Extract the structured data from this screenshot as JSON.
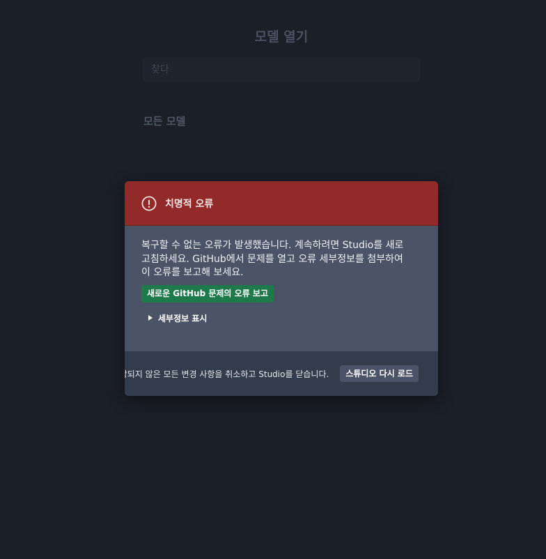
{
  "background": {
    "title": "모델 열기",
    "search_placeholder": "찾다",
    "section_label": "모든 모델"
  },
  "modal": {
    "icon": "alert-circle-icon",
    "title": "치명적 오류",
    "message_lines": [
      "복구할 수 없는 오류가 발생했습니다. 계속하려면 Studio를 새로",
      "고침하세요. GitHub에서 문제를 열고 오류 세부정보를 첨부하여",
      "이 오류를 보고해 보세요."
    ],
    "report_button": "새로운 GitHub 문제의 오류 보고",
    "details_toggle": "세부정보 표시",
    "footer_text": "저장되지 않은 모든 변경 사항을 취소하고 Studio를 닫습니다.",
    "reload_button": "스튜디오 다시 로드"
  },
  "colors": {
    "page_background": "#1b1f28",
    "header_red": "#922a2a",
    "body_slate": "#4a5466",
    "footer_dark": "#333c4b",
    "report_green": "#1f7a4b"
  }
}
